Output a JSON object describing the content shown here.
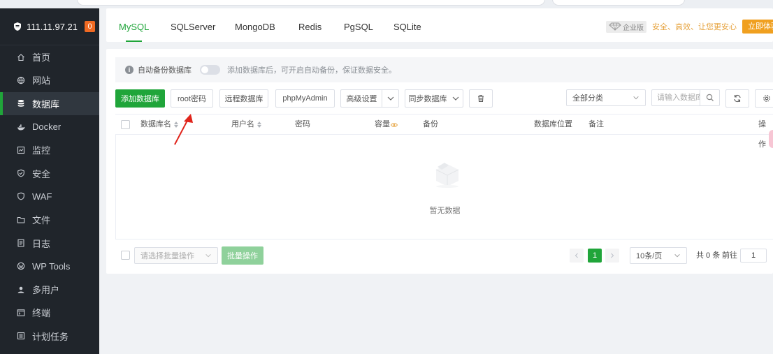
{
  "sidebar": {
    "ip": "111.11.97.21",
    "badge": "0",
    "items": [
      {
        "label": "首页",
        "icon": "home-icon"
      },
      {
        "label": "网站",
        "icon": "globe-icon"
      },
      {
        "label": "数据库",
        "icon": "database-icon",
        "active": true
      },
      {
        "label": "Docker",
        "icon": "docker-icon"
      },
      {
        "label": "监控",
        "icon": "monitor-icon"
      },
      {
        "label": "安全",
        "icon": "shield-icon"
      },
      {
        "label": "WAF",
        "icon": "waf-icon"
      },
      {
        "label": "文件",
        "icon": "folder-icon"
      },
      {
        "label": "日志",
        "icon": "log-icon"
      },
      {
        "label": "WP Tools",
        "icon": "wordpress-icon"
      },
      {
        "label": "多用户",
        "icon": "users-icon"
      },
      {
        "label": "终端",
        "icon": "terminal-icon"
      },
      {
        "label": "计划任务",
        "icon": "task-icon"
      }
    ]
  },
  "tabs": [
    "MySQL",
    "SQLServer",
    "MongoDB",
    "Redis",
    "PgSQL",
    "SQLite"
  ],
  "promo": {
    "edition": "企业版",
    "slogan": "安全、高效、让您更安心",
    "try_label": "立即体验"
  },
  "notice": {
    "label": "自动备份数据库",
    "hint": "添加数据库后，可开启自动备份，保证数据安全。"
  },
  "toolbar": {
    "add": "添加数据库",
    "root_password": "root密码",
    "remote": "远程数据库",
    "phpmyadmin": "phpMyAdmin",
    "advanced": "高级设置",
    "sync": "同步数据库",
    "category": "全部分类",
    "search_placeholder": "请输入数据库名称"
  },
  "table": {
    "headers": {
      "name": "数据库名",
      "user": "用户名",
      "password": "密码",
      "capacity": "容量",
      "backup": "备份",
      "location": "数据库位置",
      "remark": "备注",
      "action": "操作"
    },
    "empty": "暂无数据"
  },
  "footer": {
    "batch_select": "请选择批量操作",
    "batch_button": "批量操作",
    "current_page": "1",
    "page_size": "10条/页",
    "total": "共 0 条",
    "goto": "前往",
    "goto_value": "1"
  },
  "colors": {
    "accent": "#20a53a",
    "sidebar_bg": "#20252b",
    "badge": "#f06a23",
    "promo": "#e6a23c"
  }
}
